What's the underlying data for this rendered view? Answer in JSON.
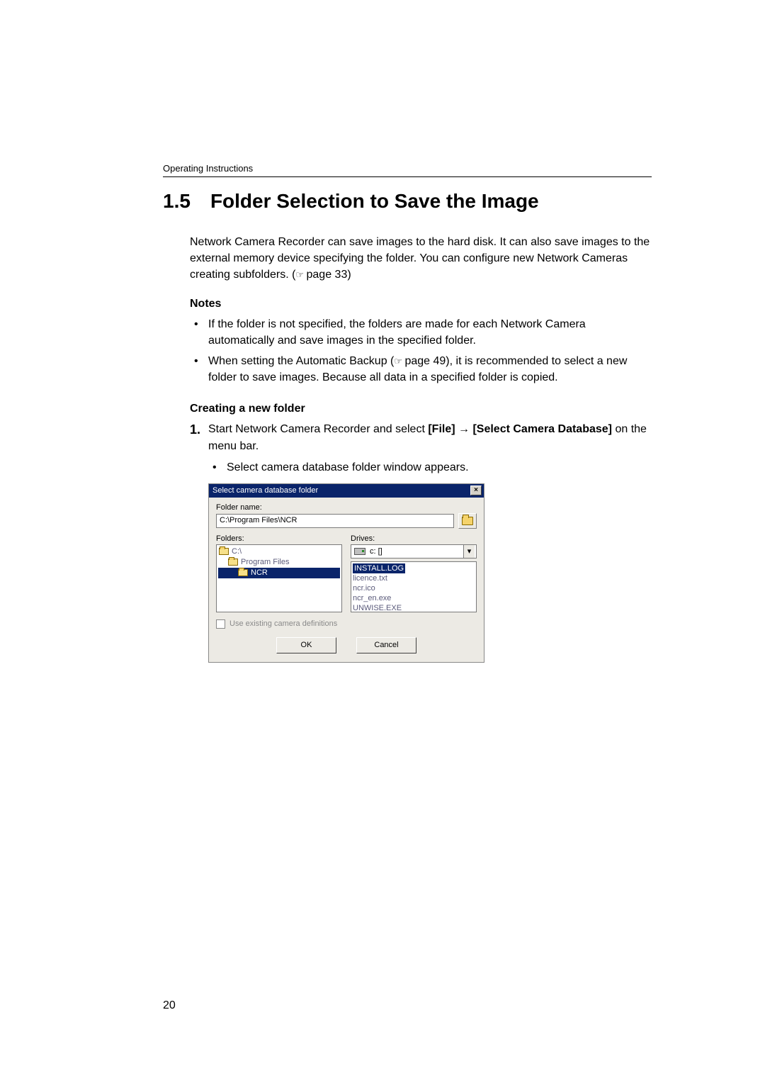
{
  "running_head": "Operating Instructions",
  "section": {
    "number": "1.5",
    "title": "Folder Selection to Save the Image"
  },
  "intro": {
    "text_a": "Network Camera Recorder can save images to the hard disk. It can also save images to the external memory device specifying the folder. You can configure new Network Cameras creating subfolders. (",
    "ref": " page 33)",
    "ref_icon": "☞"
  },
  "notes_heading": "Notes",
  "notes": [
    "If the folder is not specified, the folders are made for each Network Camera automatically and save images in the specified folder."
  ],
  "note2": {
    "a": "When setting the Automatic Backup (",
    "icon": "☞",
    "b": " page 49), it is recommended to select a new folder to save images. Because all data in a specified folder is copied."
  },
  "create_heading": "Creating a new folder",
  "step1": {
    "num": "1.",
    "a": "Start Network Camera Recorder and select ",
    "b": "[File]",
    "arrow": " → ",
    "c": "[Select Camera Database]",
    "d": " on the menu bar."
  },
  "step1_sub": "Select camera database folder window appears.",
  "dialog": {
    "title": "Select camera database folder",
    "close": "×",
    "folder_name_label": "Folder name:",
    "folder_name_value": "C:\\Program Files\\NCR",
    "folders_label": "Folders:",
    "drives_label": "Drives:",
    "tree": [
      "C:\\",
      "Program Files",
      "NCR"
    ],
    "drive": "c: []",
    "files": [
      "INSTALL.LOG",
      "licence.txt",
      "ncr.ico",
      "ncr_en.exe",
      "UNWISE.EXE"
    ],
    "checkbox_label": "Use existing camera definitions",
    "ok": "OK",
    "cancel": "Cancel"
  },
  "page_number": "20"
}
